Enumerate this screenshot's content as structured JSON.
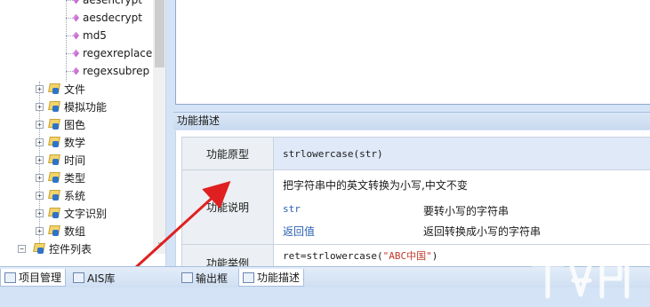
{
  "tree": {
    "functions": [
      {
        "label": "aesencrypt"
      },
      {
        "label": "aesdecrypt"
      },
      {
        "label": "md5"
      },
      {
        "label": "regexreplace"
      },
      {
        "label": "regexsubrep"
      }
    ],
    "categories": [
      {
        "label": "文件"
      },
      {
        "label": "模拟功能"
      },
      {
        "label": "图色"
      },
      {
        "label": "数学"
      },
      {
        "label": "时间"
      },
      {
        "label": "类型"
      },
      {
        "label": "系统"
      },
      {
        "label": "文字识别"
      },
      {
        "label": "数组"
      }
    ],
    "bottom_item": {
      "label": "控件列表"
    }
  },
  "description": {
    "header": "功能描述",
    "proto_key": "功能原型",
    "proto_value": "strlowercase(str)",
    "explain_key": "功能说明",
    "explain_text": "把字符串中的英文转换为小写,中文不变",
    "params": [
      {
        "name": "str",
        "desc": "要转小写的字符串"
      },
      {
        "name": "返回值",
        "desc": "返回转换成小写的字符串"
      }
    ],
    "example_key": "功能举例",
    "example_code_prefix": "ret=strlowercase(",
    "example_code_string": "\"ABC中国\"",
    "example_code_suffix": ")"
  },
  "tabs": {
    "left": [
      {
        "label": "项目管理"
      },
      {
        "label": "AIS库"
      }
    ],
    "right": [
      {
        "label": "输出框"
      },
      {
        "label": "功能描述"
      }
    ]
  },
  "colors": {
    "arrow": "#e02020",
    "header_bg": "#c9daf0",
    "proto_row_bg": "#dfe9f8"
  }
}
